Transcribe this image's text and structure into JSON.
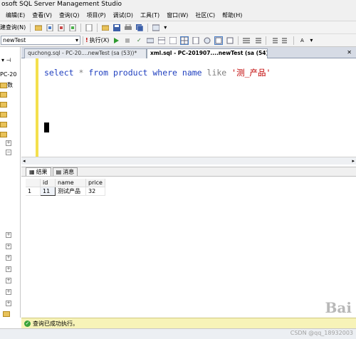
{
  "window": {
    "title": "osoft SQL Server Management Studio"
  },
  "menu": [
    "编辑(E)",
    "查看(V)",
    "查询(Q)",
    "项目(P)",
    "调试(D)",
    "工具(T)",
    "窗口(W)",
    "社区(C)",
    "帮助(H)"
  ],
  "toolbar": {
    "new_query_label": "建查询(N)",
    "database": "newTest",
    "execute_label": "执行(X)"
  },
  "object_explorer": {
    "server_label": "PC-20",
    "db_label": "数"
  },
  "tabs": [
    {
      "label": "quchong.sql - PC-20....newTest (sa (53))*",
      "active": false
    },
    {
      "label": "xml.sql - PC-201907....newTest (sa (54))*",
      "active": true
    }
  ],
  "editor": {
    "kw_select": "select",
    "star": " * ",
    "kw_from": "from",
    "table": " product ",
    "kw_where": "where",
    "column": " name ",
    "kw_like": "like",
    "literal": " '测_产品'"
  },
  "results": {
    "tab_results": "结果",
    "tab_messages": "消息",
    "columns": [
      "id",
      "name",
      "price"
    ],
    "rows": [
      {
        "row_num": "1",
        "id": "11",
        "name": "测试产品",
        "price": "32"
      }
    ]
  },
  "status": {
    "message": "查询已成功执行。"
  },
  "watermark": "Bai",
  "credit": "CSDN @qq_18932003",
  "colors": {
    "keyword": "#1f3fbf",
    "string": "#c00000",
    "gutter": "#f4e04d",
    "status_bg": "#f7f3b8"
  }
}
